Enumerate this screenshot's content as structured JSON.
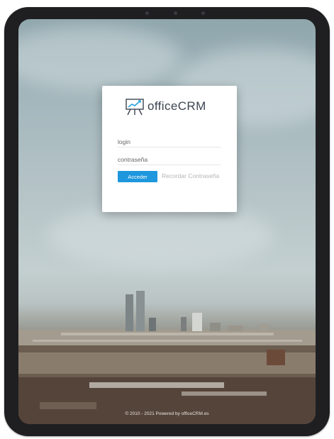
{
  "login": {
    "app_name": "officeCRM",
    "username_placeholder": "login",
    "password_placeholder": "contraseña",
    "submit_label": "Acceder",
    "forgot_password_label": "Recordar Contraseña",
    "icon": "presentation-board-icon"
  },
  "footer": {
    "text": "© 2010 - 2021 Powered by officeCRM.es"
  },
  "colors": {
    "accent": "#1e97dd",
    "logo_text": "#3b4450",
    "device_frame": "#1f1f21"
  }
}
